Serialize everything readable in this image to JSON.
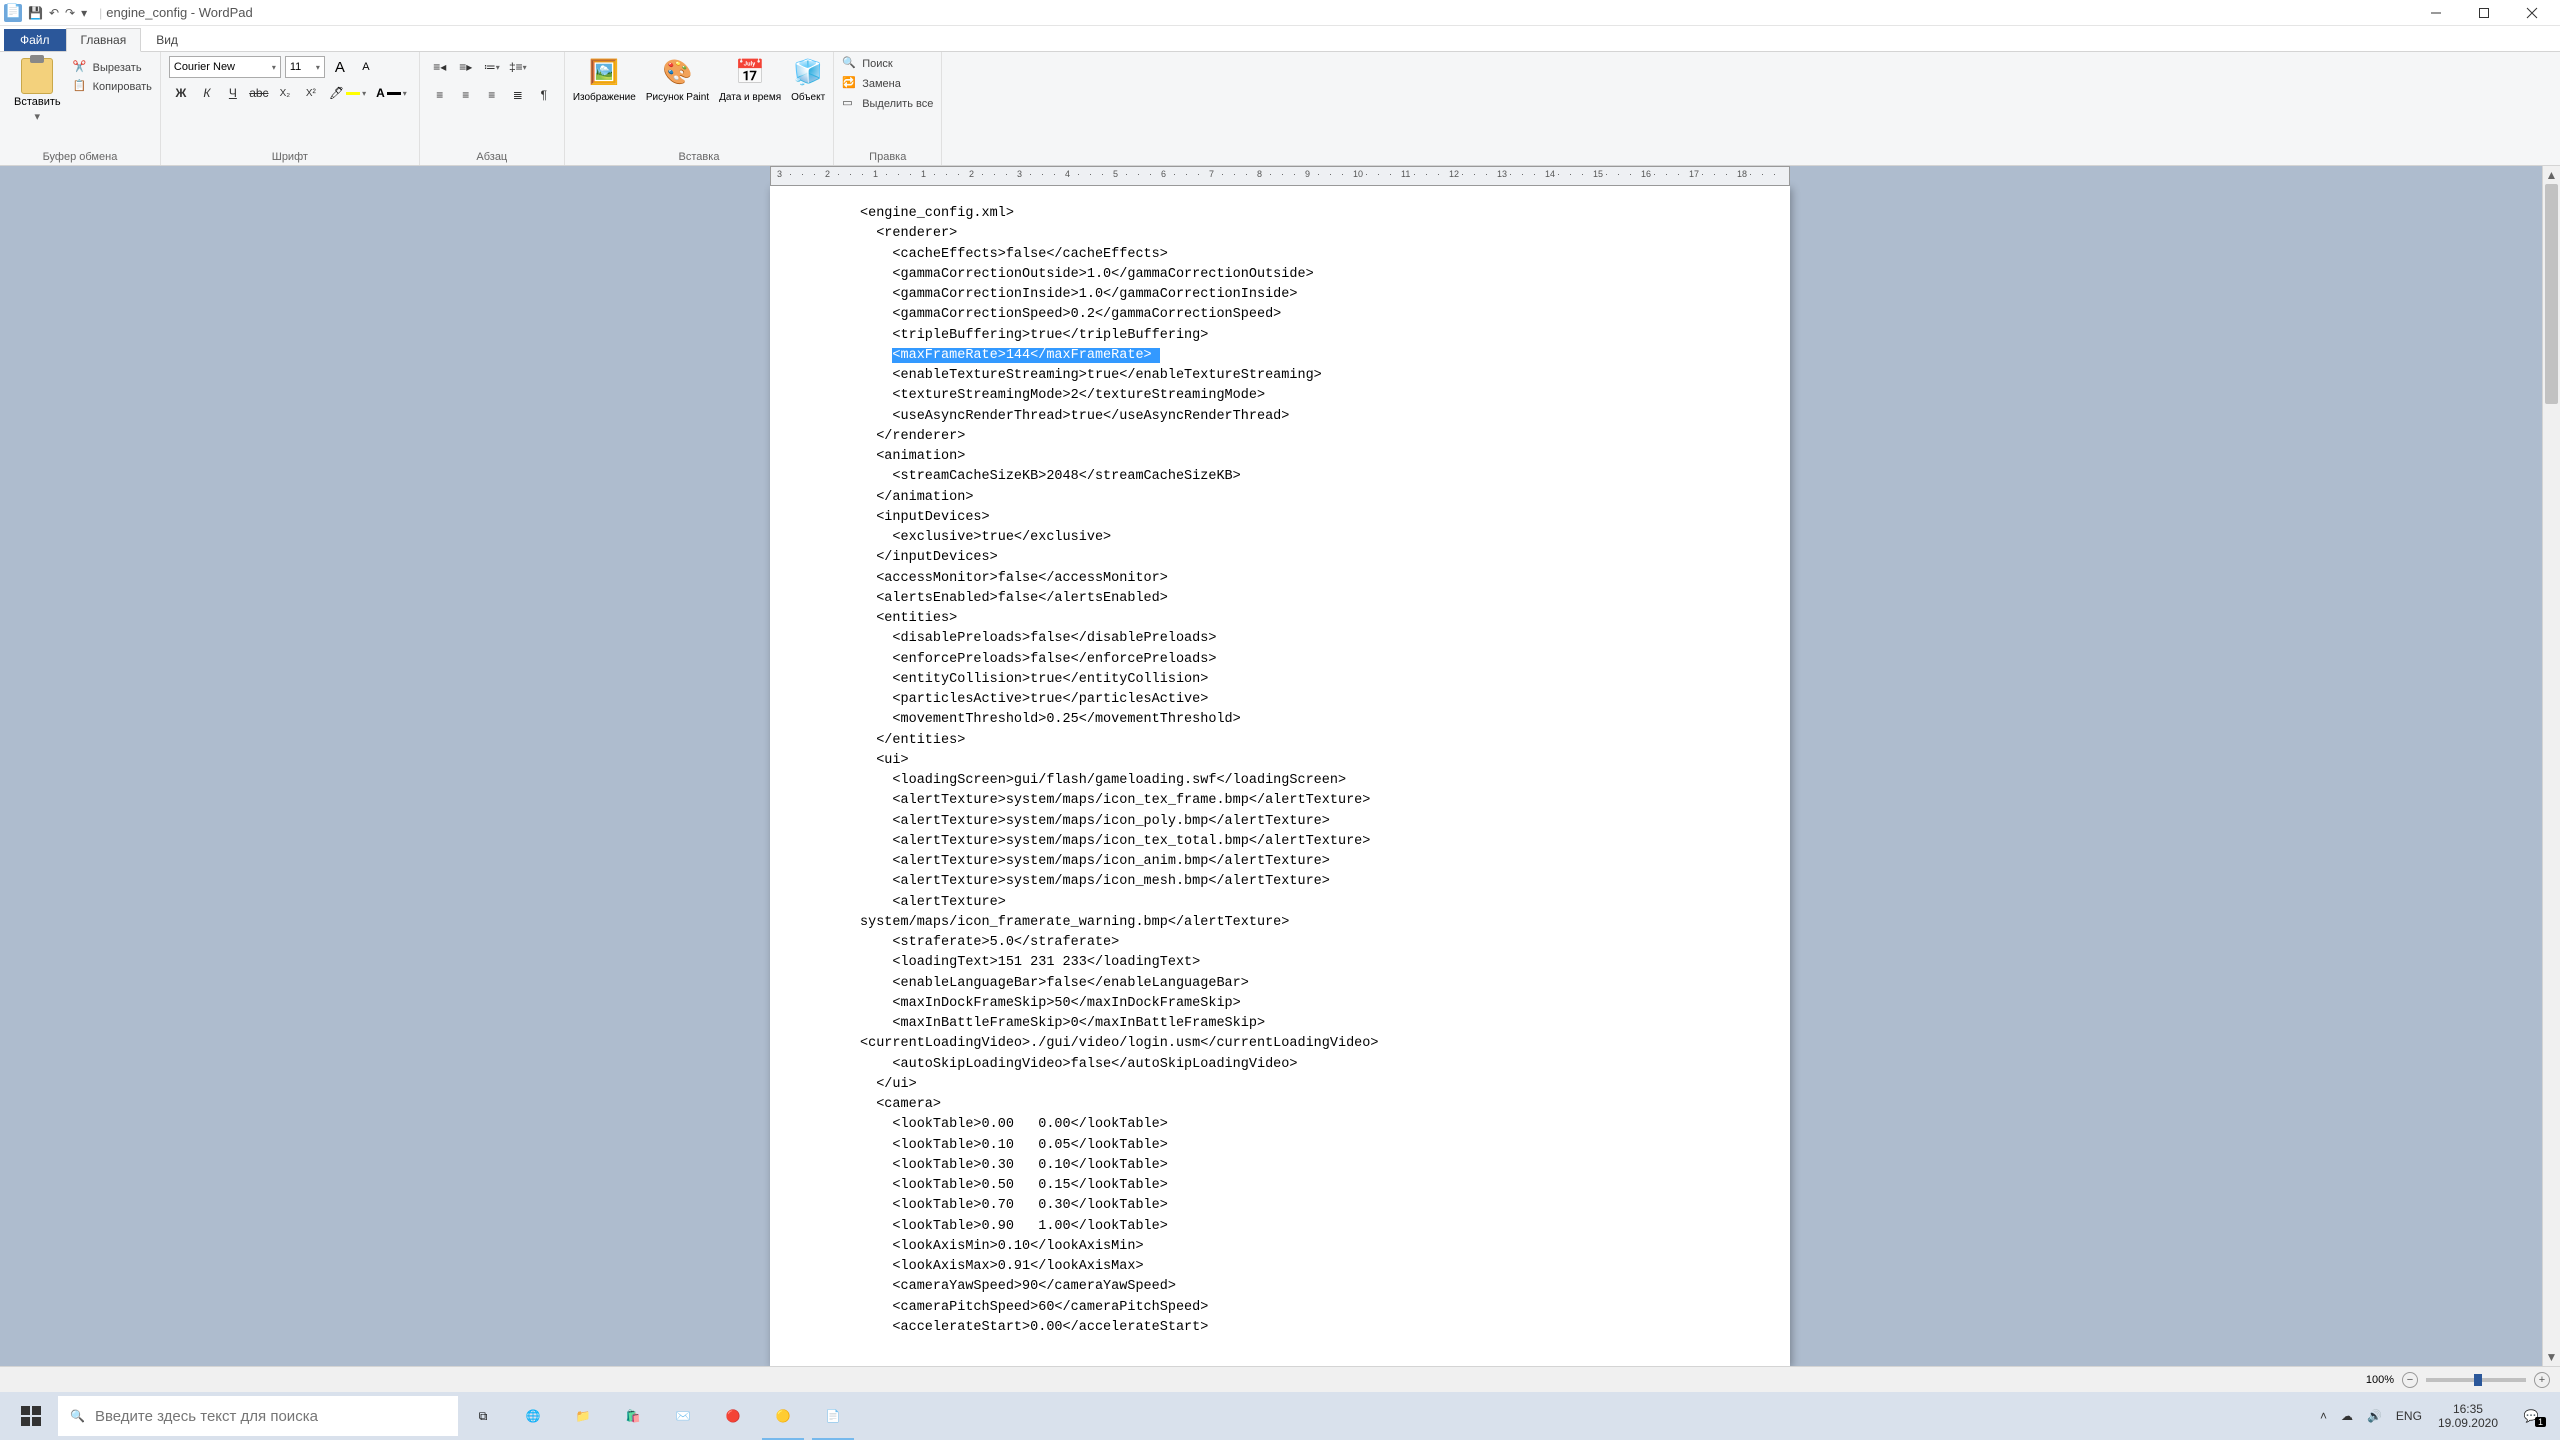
{
  "titlebar": {
    "title": "engine_config - WordPad"
  },
  "tabs": {
    "file": "Файл",
    "home": "Главная",
    "view": "Вид"
  },
  "clipboard": {
    "paste": "Вставить",
    "cut": "Вырезать",
    "copy": "Копировать",
    "group": "Буфер обмена"
  },
  "font": {
    "name": "Courier New",
    "size": "11",
    "group": "Шрифт",
    "bold": "Ж",
    "italic": "К",
    "underline": "Ч"
  },
  "paragraph": {
    "group": "Абзац"
  },
  "insert": {
    "image": "Изображение",
    "paint": "Рисунок\nPaint",
    "datetime": "Дата и\nвремя",
    "object": "Объект",
    "group": "Вставка"
  },
  "editing": {
    "find": "Поиск",
    "replace": "Замена",
    "selectall": "Выделить все",
    "group": "Правка"
  },
  "ruler": {
    "marks": [
      "3",
      "2",
      "1",
      "1",
      "2",
      "3",
      "4",
      "5",
      "6",
      "7",
      "8",
      "9",
      "10",
      "11",
      "12",
      "13",
      "14",
      "15",
      "16",
      "17",
      "18"
    ]
  },
  "document": {
    "lines": [
      "<engine_config.xml>",
      "  <renderer>",
      "    <cacheEffects>false</cacheEffects>",
      "    <gammaCorrectionOutside>1.0</gammaCorrectionOutside>",
      "    <gammaCorrectionInside>1.0</gammaCorrectionInside>",
      "    <gammaCorrectionSpeed>0.2</gammaCorrectionSpeed>",
      "    <tripleBuffering>true</tripleBuffering>",
      "    <maxFrameRate>144</maxFrameRate>",
      "    <enableTextureStreaming>true</enableTextureStreaming>",
      "    <textureStreamingMode>2</textureStreamingMode>",
      "    <useAsyncRenderThread>true</useAsyncRenderThread>",
      "  </renderer>",
      "  <animation>",
      "    <streamCacheSizeKB>2048</streamCacheSizeKB>",
      "  </animation>",
      "  <inputDevices>",
      "    <exclusive>true</exclusive>",
      "  </inputDevices>",
      "  <accessMonitor>false</accessMonitor>",
      "  <alertsEnabled>false</alertsEnabled>",
      "  <entities>",
      "    <disablePreloads>false</disablePreloads>",
      "    <enforcePreloads>false</enforcePreloads>",
      "    <entityCollision>true</entityCollision>",
      "    <particlesActive>true</particlesActive>",
      "    <movementThreshold>0.25</movementThreshold>",
      "  </entities>",
      "  <ui>",
      "    <loadingScreen>gui/flash/gameloading.swf</loadingScreen>",
      "    <alertTexture>system/maps/icon_tex_frame.bmp</alertTexture>",
      "    <alertTexture>system/maps/icon_poly.bmp</alertTexture>",
      "    <alertTexture>system/maps/icon_tex_total.bmp</alertTexture>",
      "    <alertTexture>system/maps/icon_anim.bmp</alertTexture>",
      "    <alertTexture>system/maps/icon_mesh.bmp</alertTexture>",
      "    <alertTexture>",
      "system/maps/icon_framerate_warning.bmp</alertTexture>",
      "    <straferate>5.0</straferate>",
      "    <loadingText>151 231 233</loadingText>",
      "    <enableLanguageBar>false</enableLanguageBar>",
      "    <maxInDockFrameSkip>50</maxInDockFrameSkip>",
      "    <maxInBattleFrameSkip>0</maxInBattleFrameSkip>",
      "",
      "<currentLoadingVideo>./gui/video/login.usm</currentLoadingVideo>",
      "    <autoSkipLoadingVideo>false</autoSkipLoadingVideo>",
      "  </ui>",
      "  <camera>",
      "    <lookTable>0.00   0.00</lookTable>",
      "    <lookTable>0.10   0.05</lookTable>",
      "    <lookTable>0.30   0.10</lookTable>",
      "    <lookTable>0.50   0.15</lookTable>",
      "    <lookTable>0.70   0.30</lookTable>",
      "    <lookTable>0.90   1.00</lookTable>",
      "    <lookAxisMin>0.10</lookAxisMin>",
      "    <lookAxisMax>0.91</lookAxisMax>",
      "    <cameraYawSpeed>90</cameraYawSpeed>",
      "    <cameraPitchSpeed>60</cameraPitchSpeed>",
      "    <accelerateStart>0.00</accelerateStart>"
    ],
    "highlight_index": 7
  },
  "status": {
    "zoom": "100%"
  },
  "taskbar": {
    "search_placeholder": "Введите здесь текст для поиска",
    "lang": "ENG",
    "time": "16:35",
    "date": "19.09.2020",
    "badge": "1"
  }
}
